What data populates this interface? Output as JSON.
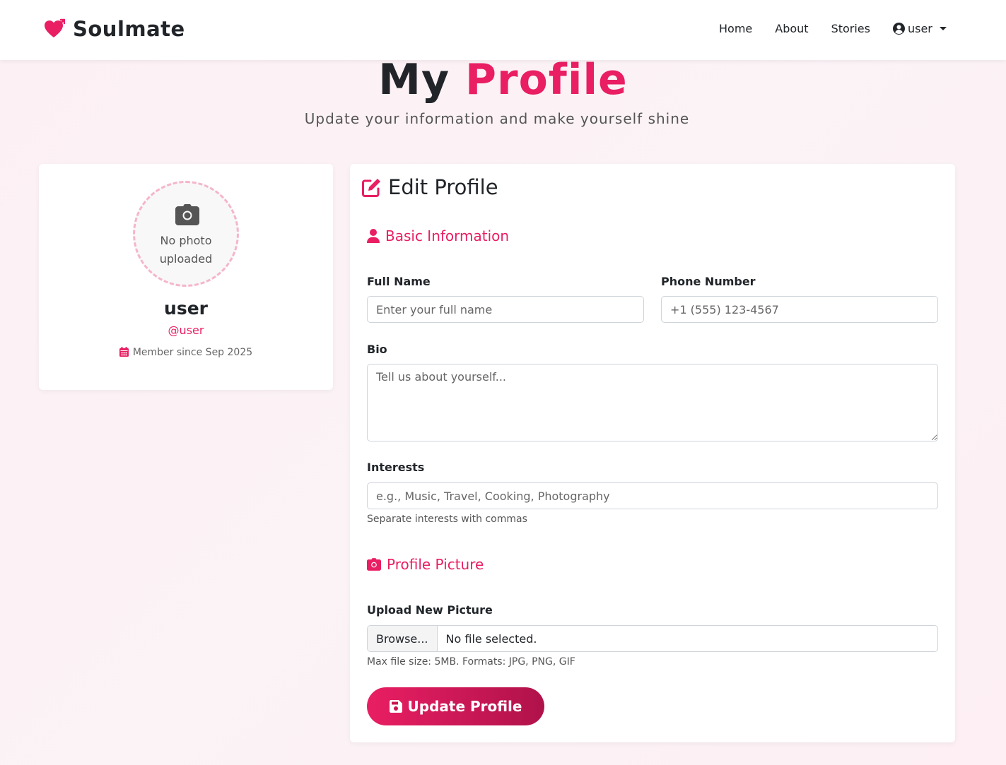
{
  "brand": {
    "name": "Soulmate",
    "icon": "heart-arrow-icon",
    "accent": "#e91e63"
  },
  "nav": {
    "links": [
      "Home",
      "About",
      "Stories"
    ],
    "user": {
      "label": "user",
      "icon": "user-circle-icon"
    }
  },
  "header": {
    "title_plain": "My",
    "title_accent": "Profile",
    "subtitle": "Update your information and make yourself shine"
  },
  "profile_card": {
    "avatar_icon": "camera-icon",
    "avatar_text": "No photo uploaded",
    "name": "user",
    "handle": "@user",
    "member_since_icon": "calendar-icon",
    "member_since": "Member since Sep 2025"
  },
  "form": {
    "title": "Edit Profile",
    "title_icon": "edit-icon",
    "basic_section": {
      "title": "Basic Information",
      "icon": "user-icon"
    },
    "full_name": {
      "label": "Full Name",
      "value": "",
      "placeholder": "Enter your full name"
    },
    "phone": {
      "label": "Phone Number",
      "value": "",
      "placeholder": "+1 (555) 123-4567"
    },
    "bio": {
      "label": "Bio",
      "value": "",
      "placeholder": "Tell us about yourself..."
    },
    "interests": {
      "label": "Interests",
      "value": "",
      "placeholder": "e.g., Music, Travel, Cooking, Photography",
      "help": "Separate interests with commas"
    },
    "picture_section": {
      "title": "Profile Picture",
      "icon": "camera-icon"
    },
    "upload": {
      "label": "Upload New Picture",
      "browse": "Browse...",
      "status": "No file selected.",
      "help": "Max file size: 5MB. Formats: JPG, PNG, GIF"
    },
    "submit": {
      "label": "Update Profile",
      "icon": "save-icon"
    }
  }
}
